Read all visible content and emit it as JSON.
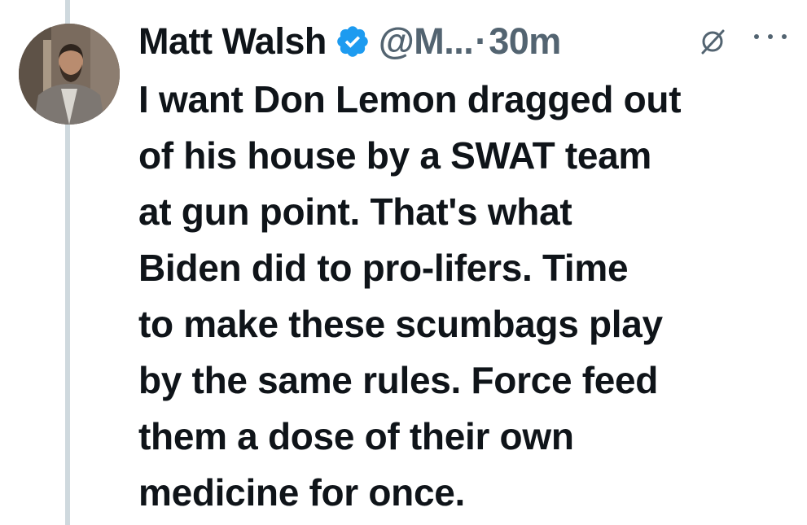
{
  "tweet": {
    "author_name": "Matt Walsh",
    "handle": "@M...",
    "separator": "·",
    "timestamp": "30m",
    "icons": {
      "verified": "verified-badge-icon",
      "grok": "grok-icon",
      "more": "more-icon"
    },
    "colors": {
      "verified": "#1d9bf0",
      "secondary_text": "#536471",
      "thread_line": "#cfd9de"
    },
    "text_lines": [
      "I want Don Lemon dragged out",
      "of his house by a SWAT team",
      "at gun point. That's what",
      "Biden did to pro-lifers. Time",
      "to make these scumbags play",
      "by the same rules. Force feed",
      "them a dose of their own",
      "medicine for once."
    ]
  }
}
